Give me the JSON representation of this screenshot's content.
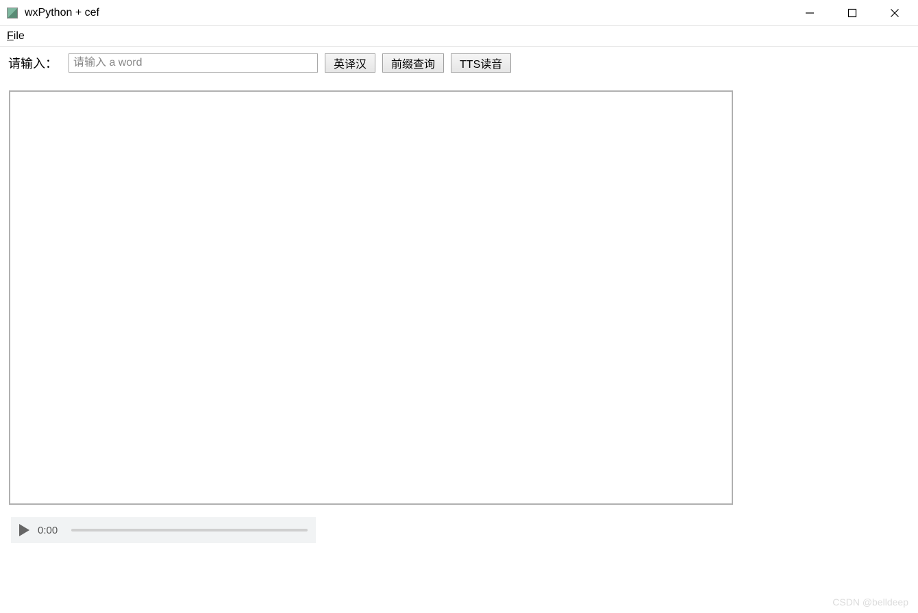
{
  "window": {
    "title": "wxPython + cef"
  },
  "menu": {
    "file_label": "File",
    "file_mnemonic": "F"
  },
  "toolbar": {
    "input_label": "请输入：",
    "input_placeholder": "请输入 a word",
    "btn_translate": "英译汉",
    "btn_prefix": "前缀查询",
    "btn_tts": "TTS读音"
  },
  "audio": {
    "time": "0:00"
  },
  "watermark": "CSDN @belldeep"
}
